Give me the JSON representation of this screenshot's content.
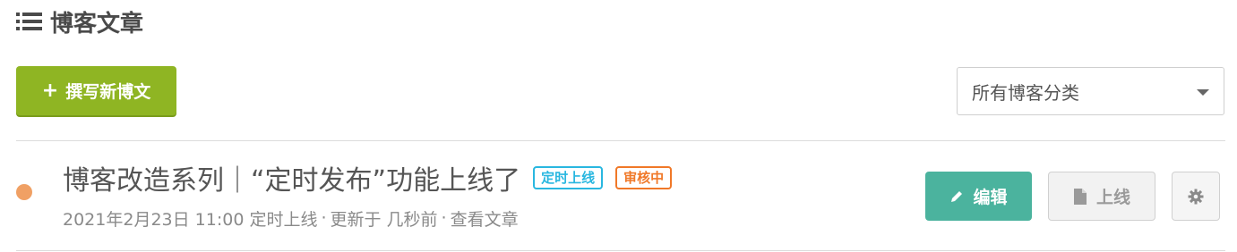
{
  "header": {
    "title": "博客文章",
    "icon": "list-icon"
  },
  "toolbar": {
    "new_post_label": "撰写新博文",
    "new_post_icon": "plus-icon",
    "category_filter": {
      "selected": "所有博客分类"
    }
  },
  "posts": [
    {
      "title": "博客改造系列｜“定时发布”功能上线了",
      "status_dot_color": "#f0a064",
      "badges": [
        {
          "label": "定时上线",
          "color": "#29b7e0"
        },
        {
          "label": "审核中",
          "color": "#f07828"
        }
      ],
      "meta": {
        "scheduled": "2021年2月23日 11:00 定时上线",
        "updated": "更新于 几秒前",
        "view_link": "查看文章",
        "separator": "·"
      },
      "actions": {
        "edit_label": "编辑",
        "publish_label": "上线",
        "settings_icon": "gear-icon"
      }
    }
  ],
  "colors": {
    "primary_green": "#8fb523",
    "edit_teal": "#4bb39e"
  }
}
